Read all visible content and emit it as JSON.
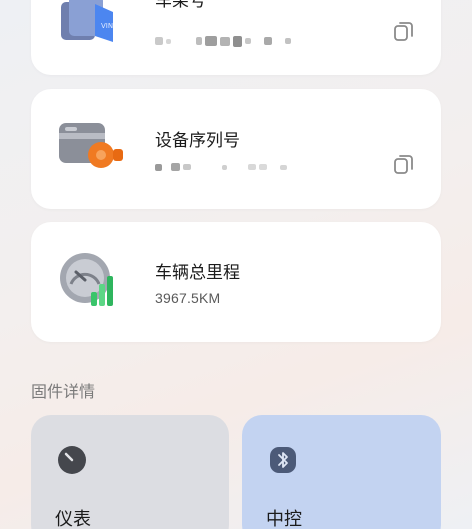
{
  "cards": [
    {
      "title": "车架号",
      "value_masked": true
    },
    {
      "title": "设备序列号",
      "value_masked": true
    },
    {
      "title": "车辆总里程",
      "value": "3967.5KM"
    }
  ],
  "icons": {
    "vin": "vin-document-icon",
    "serial": "device-serial-icon",
    "mileage": "odometer-icon",
    "copy": "copy-icon",
    "dashboard": "dashboard-dial-icon",
    "center": "bluetooth-icon"
  },
  "section": {
    "firmware_label": "固件详情"
  },
  "firmware": [
    {
      "label": "仪表",
      "color": "#dcdde2"
    },
    {
      "label": "中控",
      "color": "#c3d3f1"
    }
  ]
}
